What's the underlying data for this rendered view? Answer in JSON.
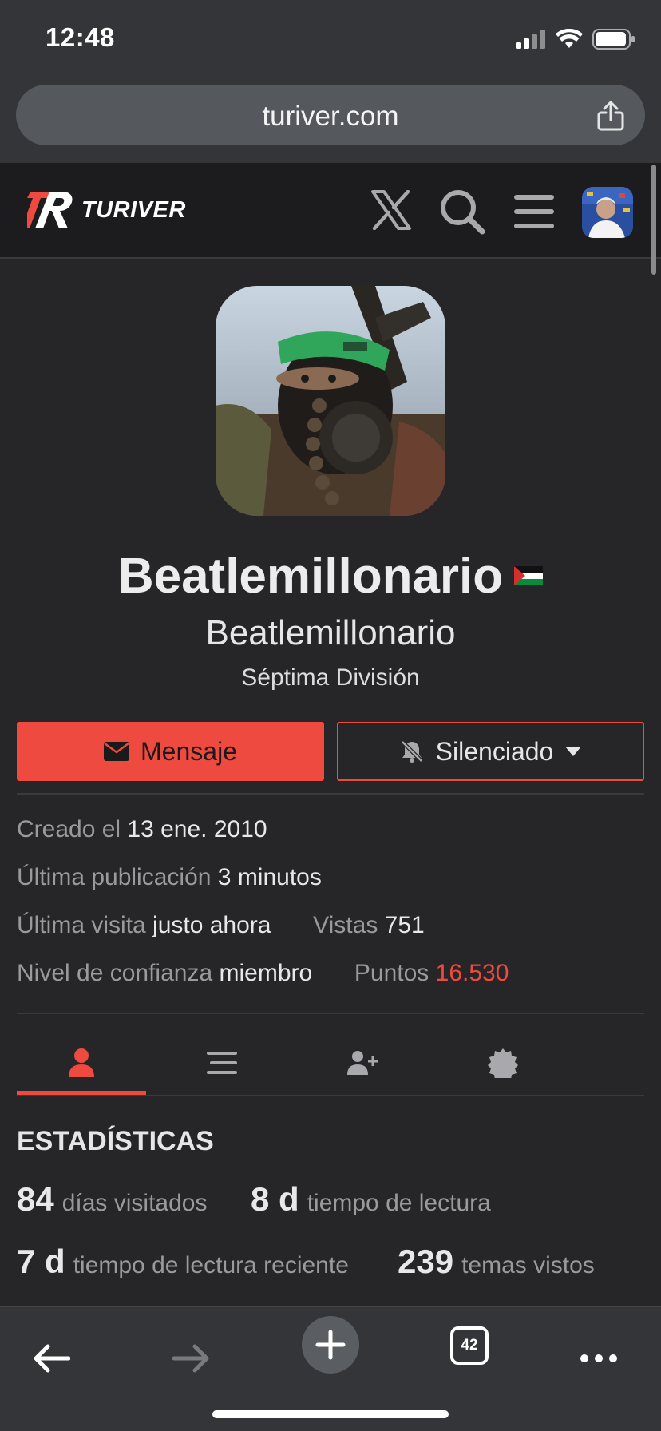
{
  "status_bar": {
    "time": "12:48"
  },
  "browser": {
    "url": "turiver.com",
    "tab_count": "42"
  },
  "site": {
    "logo_text": "TURIVER"
  },
  "profile": {
    "username": "Beatlemillonario",
    "full_name": "Beatlemillonario",
    "user_title": "Séptima División",
    "message_button": "Mensaje",
    "notification_button": "Silenciado"
  },
  "meta": {
    "created_label": "Creado el",
    "created_value": "13 ene. 2010",
    "last_post_label": "Última publicación",
    "last_post_value": "3 minutos",
    "last_seen_label": "Última visita",
    "last_seen_value": "justo ahora",
    "views_label": "Vistas",
    "views_value": "751",
    "trust_label": "Nivel de confianza",
    "trust_value": "miembro",
    "points_label": "Puntos",
    "points_value": "16.530"
  },
  "tabs": [
    {
      "name": "summary",
      "icon": "user-icon",
      "active": true
    },
    {
      "name": "activity",
      "icon": "list-icon",
      "active": false
    },
    {
      "name": "invites",
      "icon": "user-plus-icon",
      "active": false
    },
    {
      "name": "badges",
      "icon": "badge-icon",
      "active": false
    }
  ],
  "stats": {
    "heading": "ESTADÍSTICAS",
    "items": [
      {
        "value": "84",
        "label": "días visitados"
      },
      {
        "value": "8 d",
        "label": "tiempo de lectura"
      },
      {
        "value": "7 d",
        "label": "tiempo de lectura reciente"
      },
      {
        "value": "239",
        "label": "temas vistos"
      }
    ]
  },
  "colors": {
    "accent": "#ef4a3f",
    "background": "#262628",
    "header": "#1c1c1e",
    "browser_chrome": "#333538"
  }
}
